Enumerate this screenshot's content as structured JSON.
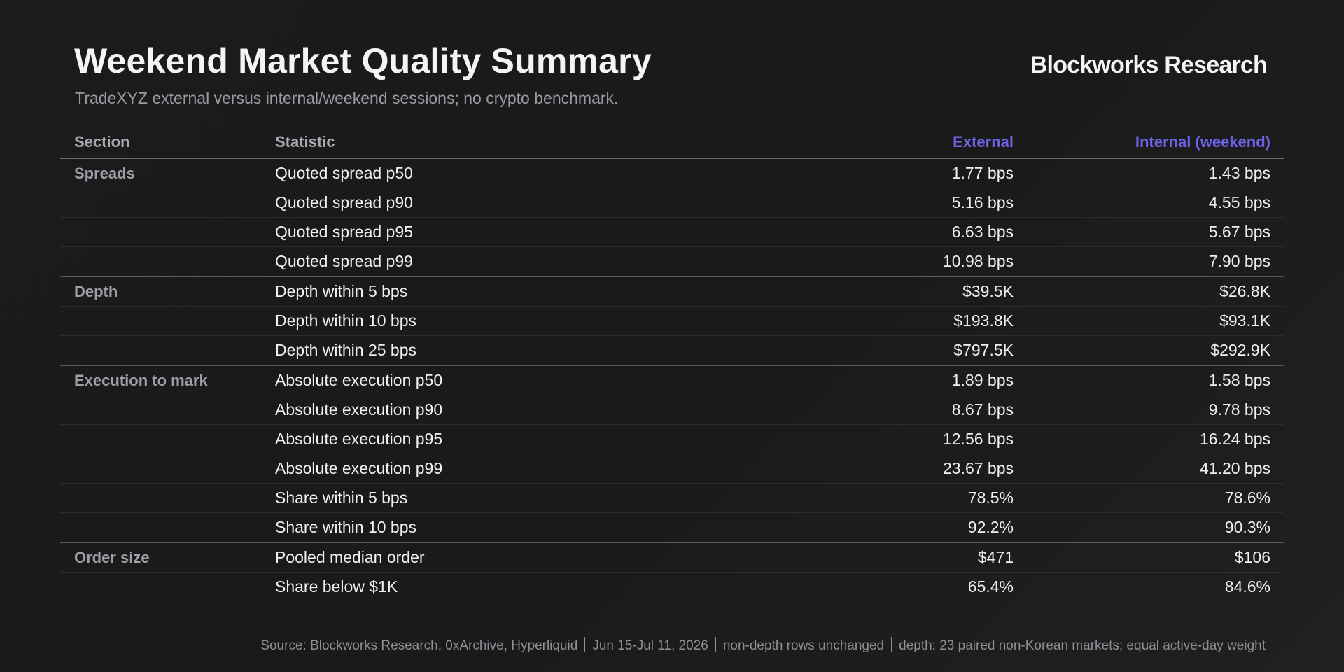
{
  "header": {
    "title": "Weekend Market Quality Summary",
    "subtitle": "TradeXYZ external versus internal/weekend sessions; no crypto benchmark.",
    "brand": "Blockworks Research"
  },
  "colors": {
    "background": "#1b1b1b",
    "accent": "#6d63e6",
    "muted_text": "#9a9aa3"
  },
  "table": {
    "columns": [
      "Section",
      "Statistic",
      "External",
      "Internal (weekend)"
    ],
    "rows": [
      [
        "Spreads",
        "Quoted spread p50",
        "1.77 bps",
        "1.43 bps"
      ],
      [
        "",
        "Quoted spread p90",
        "5.16 bps",
        "4.55 bps"
      ],
      [
        "",
        "Quoted spread p95",
        "6.63 bps",
        "5.67 bps"
      ],
      [
        "",
        "Quoted spread p99",
        "10.98 bps",
        "7.90 bps"
      ],
      [
        "Depth",
        "Depth within 5 bps",
        "$39.5K",
        "$26.8K"
      ],
      [
        "",
        "Depth within 10 bps",
        "$193.8K",
        "$93.1K"
      ],
      [
        "",
        "Depth within 25 bps",
        "$797.5K",
        "$292.9K"
      ],
      [
        "Execution to mark",
        "Absolute execution p50",
        "1.89 bps",
        "1.58 bps"
      ],
      [
        "",
        "Absolute execution p90",
        "8.67 bps",
        "9.78 bps"
      ],
      [
        "",
        "Absolute execution p95",
        "12.56 bps",
        "16.24 bps"
      ],
      [
        "",
        "Absolute execution p99",
        "23.67 bps",
        "41.20 bps"
      ],
      [
        "",
        "Share within 5 bps",
        "78.5%",
        "78.6%"
      ],
      [
        "",
        "Share within 10 bps",
        "92.2%",
        "90.3%"
      ],
      [
        "Order size",
        "Pooled median order",
        "$471",
        "$106"
      ],
      [
        "",
        "Share below $1K",
        "65.4%",
        "84.6%"
      ]
    ]
  },
  "footer": {
    "parts": [
      "Source: Blockworks Research, 0xArchive, Hyperliquid",
      "Jun 15-Jul 11, 2026",
      "non-depth rows unchanged",
      "depth: 23 paired non-Korean markets; equal active-day weight"
    ]
  }
}
